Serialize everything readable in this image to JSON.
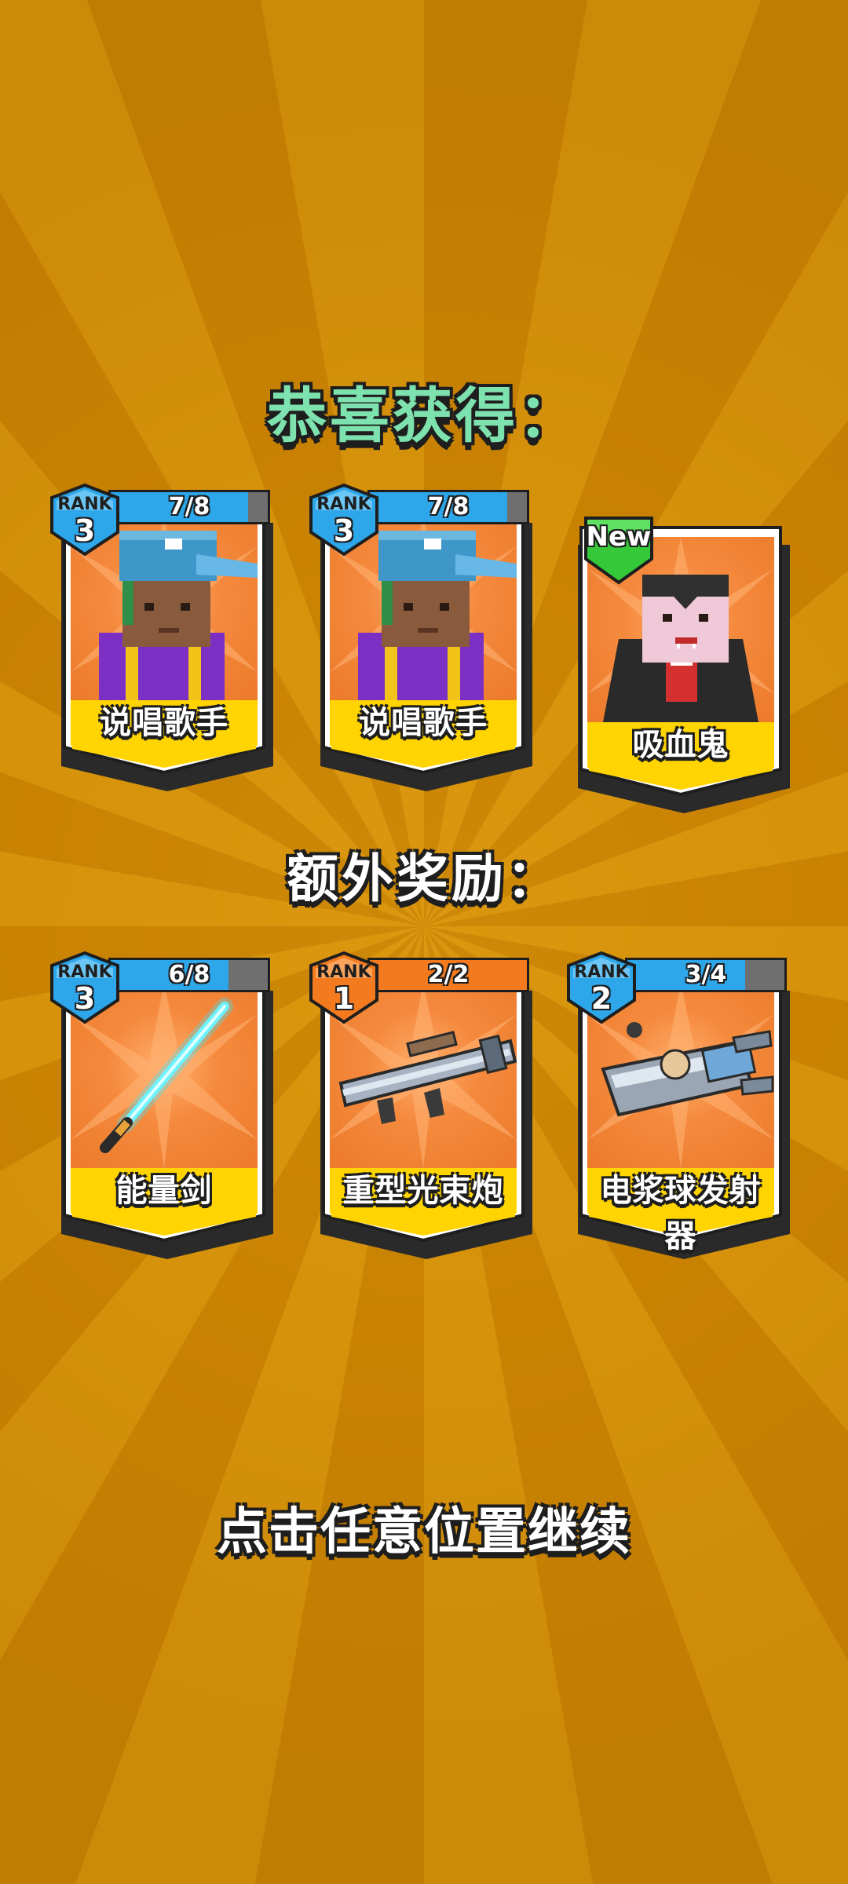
{
  "title": "恭喜获得：",
  "bonus_title": "额外奖励：",
  "continue_hint": "点击任意位置继续",
  "colors": {
    "background": "#d08a06",
    "title_green": "#7de2ae",
    "card_orange": "#f58a3e",
    "band_yellow": "#ffd400",
    "rank_blue": "#2da6ea",
    "rank_orange": "#f37a1e",
    "new_green": "#35c93a"
  },
  "rewards": [
    {
      "name": "说唱歌手",
      "rank_label": "RANK",
      "rank": "3",
      "progress_text": "7/8",
      "progress": 0.875,
      "badge_color": "blue",
      "art": "rapper-icon"
    },
    {
      "name": "说唱歌手",
      "rank_label": "RANK",
      "rank": "3",
      "progress_text": "7/8",
      "progress": 0.875,
      "badge_color": "blue",
      "art": "rapper-icon"
    },
    {
      "name": "吸血鬼",
      "new_label": "New",
      "art": "vampire-icon"
    }
  ],
  "bonus": [
    {
      "name": "能量剑",
      "rank_label": "RANK",
      "rank": "3",
      "progress_text": "6/8",
      "progress": 0.75,
      "badge_color": "blue",
      "art": "energy-sword-icon"
    },
    {
      "name": "重型光束炮",
      "rank_label": "RANK",
      "rank": "1",
      "progress_text": "2/2",
      "progress": 1.0,
      "badge_color": "orange",
      "art": "heavy-beam-cannon-icon"
    },
    {
      "name": "电浆球发射器",
      "rank_label": "RANK",
      "rank": "2",
      "progress_text": "3/4",
      "progress": 0.75,
      "badge_color": "blue",
      "art": "plasma-ball-launcher-icon"
    }
  ]
}
